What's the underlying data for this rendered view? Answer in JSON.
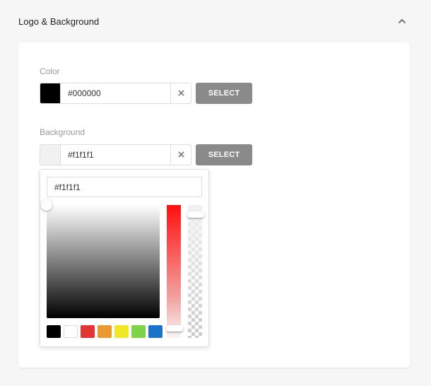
{
  "section": {
    "title": "Logo & Background"
  },
  "color_field": {
    "label": "Color",
    "value": "#000000",
    "swatch": "#000000",
    "select_label": "SELECT"
  },
  "background_field": {
    "label": "Background",
    "value": "#f1f1f1",
    "swatch": "#f1f1f1",
    "select_label": "SELECT"
  },
  "picker": {
    "hex_value": "#f1f1f1",
    "presets": [
      "#000000",
      "#ffffff",
      "#e33535",
      "#e89a2e",
      "#f0e826",
      "#7fd348",
      "#1a73c9"
    ]
  },
  "icons": {
    "collapse": "chevron-up-icon",
    "clear": "close-icon"
  }
}
